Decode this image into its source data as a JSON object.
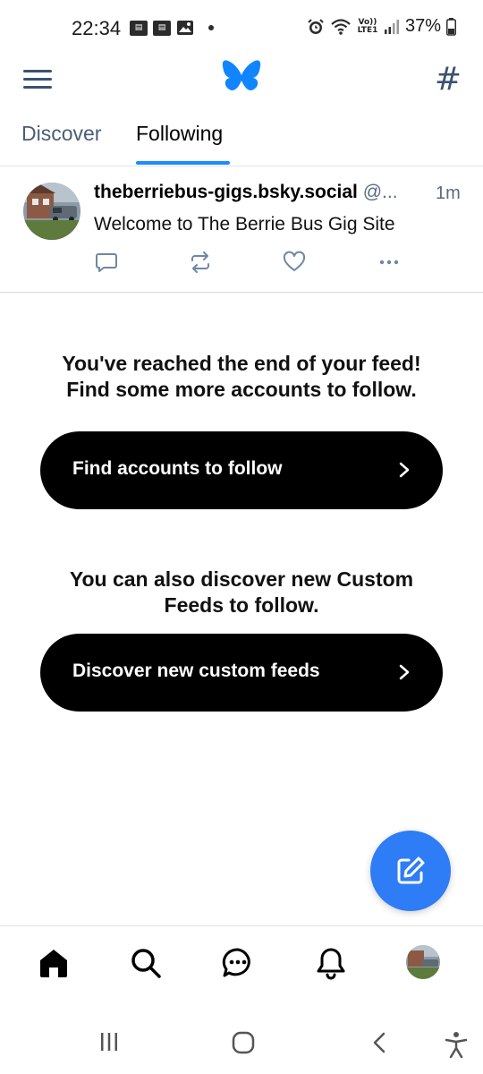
{
  "status_bar": {
    "time": "22:34",
    "battery": "37%",
    "network_label": "Vo)) LTE1",
    "icons": [
      "notification-box-icon",
      "notification-box-icon",
      "gallery-icon",
      "dot-icon",
      "alarm-icon",
      "wifi-icon",
      "volte-icon",
      "signal-icon",
      "battery-icon"
    ]
  },
  "app_bar": {
    "menu_icon": "hamburger-menu-icon",
    "logo": "bluesky-butterfly-logo",
    "feeds_icon": "hash-icon",
    "hash_glyph": "#"
  },
  "tabs": [
    {
      "label": "Discover",
      "selected": false
    },
    {
      "label": "Following",
      "selected": true
    }
  ],
  "post": {
    "author": "theberriebus-gigs.bsky.social",
    "handle": "@...",
    "time": "1m",
    "text": "Welcome to The Berrie Bus Gig Site",
    "actions": [
      "reply-icon",
      "repost-icon",
      "like-icon",
      "more-icon"
    ]
  },
  "end_of_feed": {
    "message_line1": "You've reached the end of your feed!",
    "message_line2": "Find some more accounts to follow.",
    "find_button": "Find accounts to follow",
    "custom_line1": "You can also discover new Custom",
    "custom_line2": "Feeds to follow.",
    "discover_button": "Discover new custom feeds"
  },
  "fab": {
    "icon": "compose-icon"
  },
  "bottom_nav": [
    "home-icon",
    "search-icon",
    "chat-icon",
    "bell-icon",
    "profile-avatar"
  ],
  "system_nav": [
    "recents-icon",
    "home-circle-icon",
    "back-icon",
    "accessibility-icon"
  ],
  "colors": {
    "accent": "#1a8cff",
    "fab": "#2e7cf6",
    "butterfly": "#1185fe",
    "muted_text": "#5a6b80",
    "button_bg": "#000000"
  }
}
